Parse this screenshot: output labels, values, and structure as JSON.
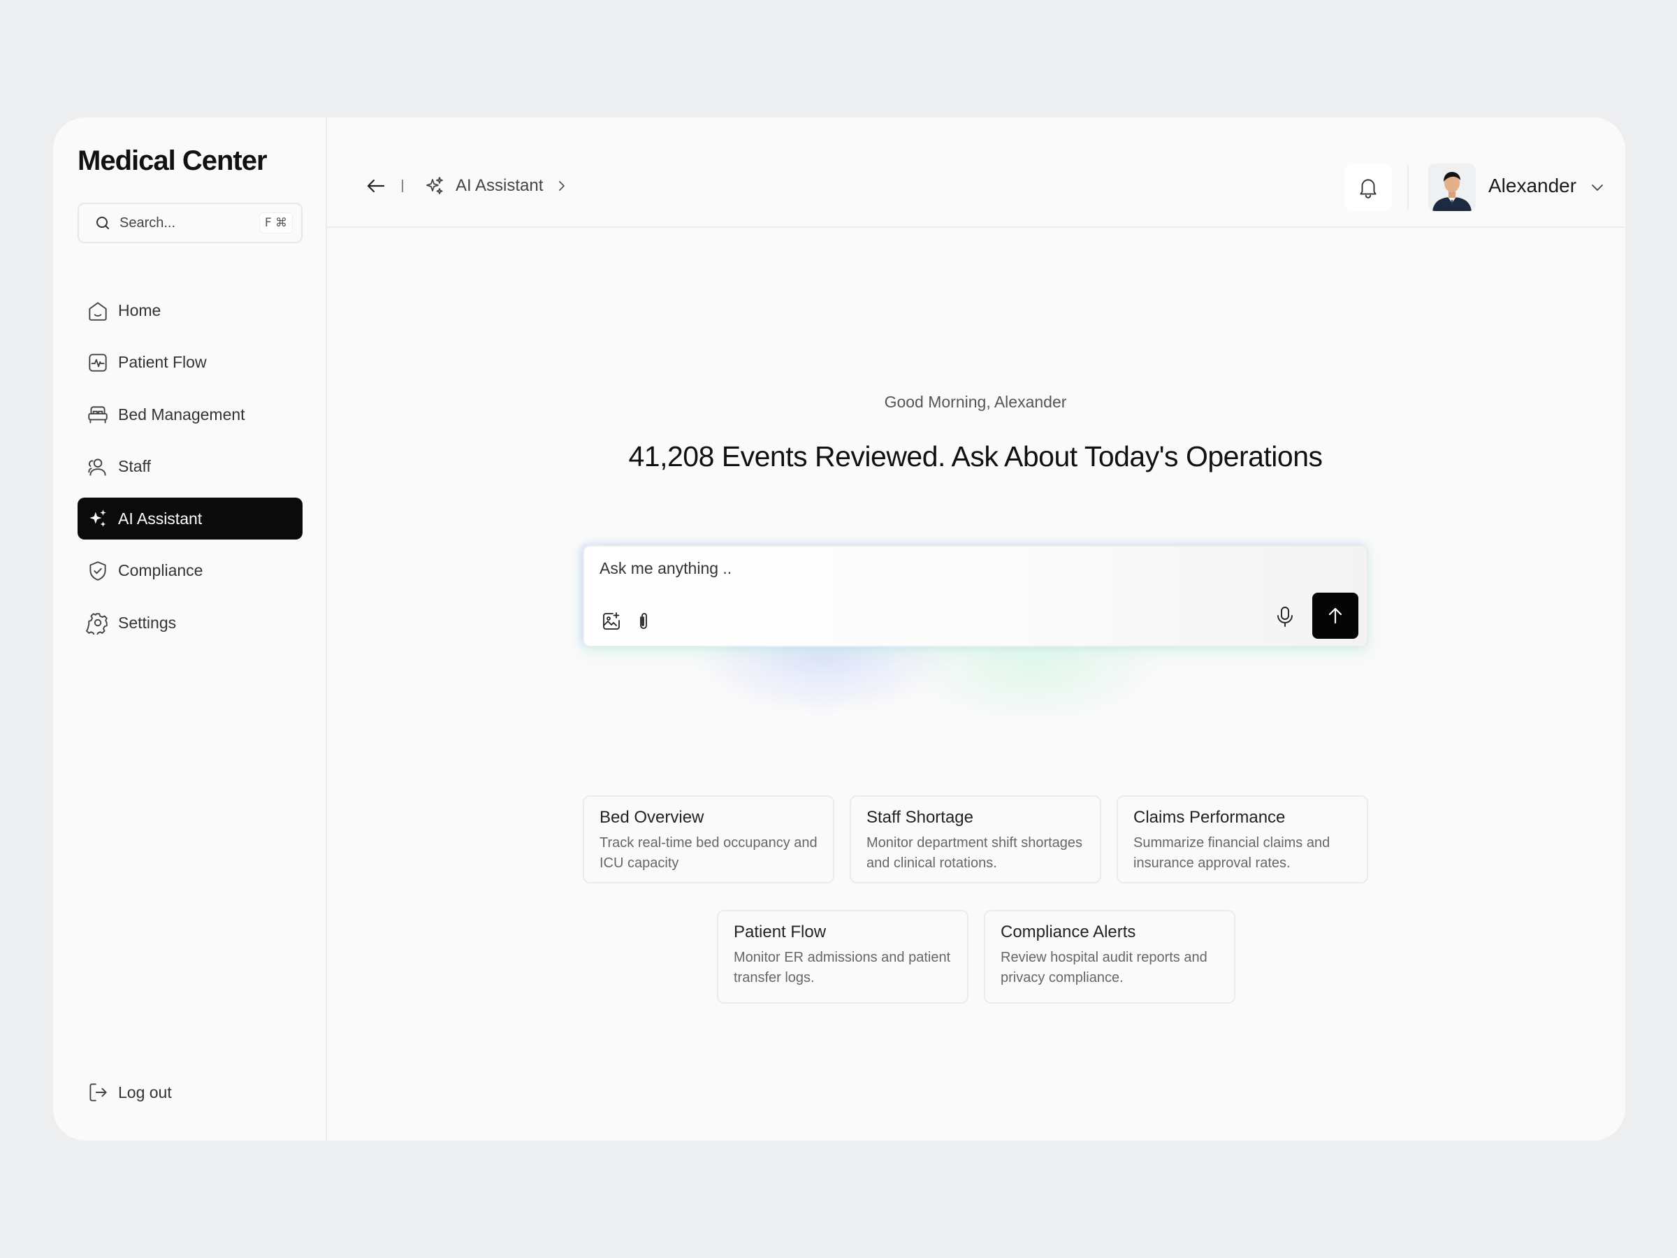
{
  "brand": {
    "name": "Medical Center"
  },
  "search": {
    "placeholder": "Search...",
    "shortcut": "F ⌘"
  },
  "nav": {
    "items": [
      {
        "label": "Home",
        "icon": "home-icon"
      },
      {
        "label": "Patient Flow",
        "icon": "activity-icon"
      },
      {
        "label": "Bed Management",
        "icon": "bed-icon"
      },
      {
        "label": "Staff",
        "icon": "users-icon"
      },
      {
        "label": "AI Assistant",
        "icon": "sparkles-icon",
        "active": true
      },
      {
        "label": "Compliance",
        "icon": "shield-check-icon"
      },
      {
        "label": "Settings",
        "icon": "gear-icon"
      }
    ],
    "logout_label": "Log out"
  },
  "topbar": {
    "breadcrumb_label": "AI Assistant",
    "user_name": "Alexander"
  },
  "main": {
    "greeting": "Good Morning, Alexander",
    "headline": "41,208 Events Reviewed. Ask About Today's Operations",
    "prompt_placeholder": "Ask me anything .."
  },
  "cards": [
    {
      "title": "Bed Overview",
      "desc": "Track real-time bed occupancy and ICU capacity"
    },
    {
      "title": "Staff Shortage",
      "desc": "Monitor department shift shortages and clinical rotations."
    },
    {
      "title": "Claims Performance",
      "desc": "Summarize financial claims and insurance approval rates."
    },
    {
      "title": "Patient Flow",
      "desc": "Monitor ER admissions and patient transfer logs."
    },
    {
      "title": "Compliance Alerts",
      "desc": "Review hospital audit reports and privacy compliance."
    }
  ],
  "colors": {
    "accent": "#0b0b0b",
    "background": "#edeef0",
    "panel": "#fafafa"
  }
}
